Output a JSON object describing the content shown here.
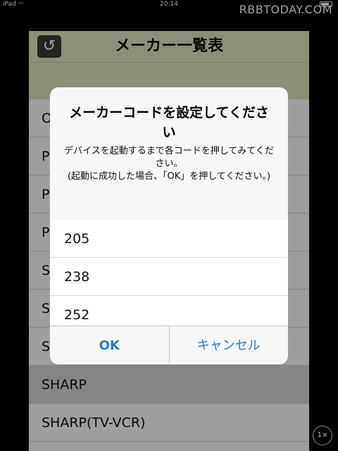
{
  "status_bar": {
    "carrier": "iPad",
    "wifi_icon": "wifi-icon",
    "time": "20:14",
    "battery_icon": "battery-icon"
  },
  "watermark": "RBBTODAY.COM",
  "navbar": {
    "title": "メーカー一覧表",
    "back_icon": "refresh-back-icon"
  },
  "manufacturer_list": [
    "O",
    "P",
    "P",
    "P",
    "S",
    "S",
    "S",
    "SHARP",
    "SHARP(TV-VCR)"
  ],
  "selected_manufacturer": "SHARP",
  "alert": {
    "title": "メーカーコードを設定してください",
    "message": "デバイスを起動するまで各コードを押してみてください。\n(起動に成功した場合、「OK」を押してください。)",
    "codes": [
      "205",
      "238",
      "252"
    ],
    "ok_label": "OK",
    "cancel_label": "キャンセル",
    "button_color": "#2b7ad1"
  },
  "zoom_button": "1×"
}
